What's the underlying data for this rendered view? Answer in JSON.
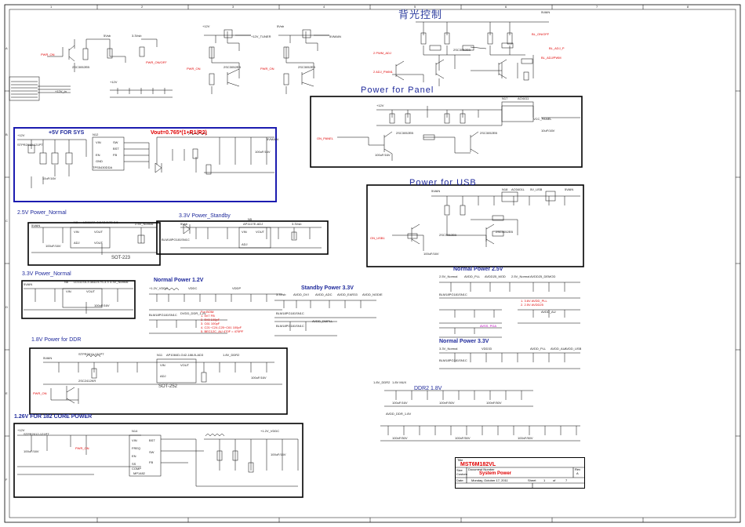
{
  "header_cn": "背光控制",
  "sections": {
    "panel": "Power for Panel",
    "usb": "Power for USB",
    "sys": "+5V FOR SYS",
    "formula": "Vout=0.765*(1+R1/R2)",
    "v25": "2.5V Power_Normal",
    "v33s": "3.3V Power_Standby",
    "v33n": "3.3V Power_Normal",
    "ddr": "1.8V Power for DDR",
    "core": "1.26V FOR 182 CORE POWER",
    "np12": "Normal Power 1.2V",
    "sp33": "Standby Power 3.3V",
    "np25": "Normal Power 2.5V",
    "np33": "Normal Power 3.3V",
    "ddr2": "DDR2 1.8V",
    "sot223": "SOT-223",
    "sot252": "SOT-252"
  },
  "nets": {
    "pwr_on": "PWR_ON",
    "pwr_on_off": "PWR_ON/OFF",
    "v12in": "+12V_in",
    "v5": "5Vsb",
    "v33": "3.3Vsb",
    "v12": "+12V",
    "v12_tuner": "+12V_TUNER",
    "v5main": "5VMAIN",
    "v5vain": "5VAIN",
    "bl_on": "BL_ON/OFF",
    "adj_p": "BL_ADJ_P",
    "adj_pwm": "BL_ADJ/PWM",
    "pwm_adj": "2 PWM_ADJ",
    "pwm0": "2 PWM_PWM0",
    "adj_pwm1": "2 ADJ_PWM1",
    "bl_adjust": "BL_ADJUST",
    "bl_onoff": "BL_ON/OFF",
    "tuner": "12V_TUNER",
    "vcc_panel": "VCC_PANEL",
    "on_panel": "ON_PANEL",
    "v5usb": "5V_USB",
    "on_usb": "ON_USB1",
    "v25n": "2.5V_Normal",
    "v33n": "3.3V_Normal",
    "avdd_ddr": "AVDD_DDR_1.8V",
    "v18ddr": "1.8V_DDR2",
    "v12vddc": "+1.2V_VDDC",
    "avdd_mux": "1.8V MUX",
    "avdd_ddr2": "AVDD_DDR_1.8V",
    "vddp": "VDDP",
    "vddc": "VDDC",
    "avdd_dvi": "AVDD_DVI",
    "avdd_adc": "AVDD_ADC",
    "avdd_ear33": "AVDD_EAR33",
    "avdd_nodie": "AVDD_NODIE",
    "avdd_dmpll": "AVDD_DMPLL",
    "avdd_pll": "AVDD_PLL",
    "avdd_usb": "AVDD_USB",
    "avdd_au": "AVDD_AU",
    "avdd_lpll": "AVDD_LPLL",
    "avdd_demod": "AVDD25_DEMOD",
    "avdd_mod": "AVDD25_MOD",
    "avdd_pga": "AVSS_PGA",
    "vddq": "VDDQ",
    "v33io": "VDD33",
    "vdd_ddr": "DVDD_DDR_1.2V",
    "avdd_rtw": "AVDD_PLL"
  },
  "parts": {
    "u12": "N12",
    "u12_part": "TPS5430DDA",
    "l_sys": "L_SYS",
    "u17": "N17",
    "u17_part": "AO4411",
    "u8": "N8",
    "u8_part": "LD1117A-2.5ADJ17S-2.5",
    "u5": "N5",
    "u5_part": "AP1117E-ADJ",
    "u6": "N6",
    "u6_part": "LD1117A-3.3ADJ17S-3.3",
    "u11": "N11",
    "u11_part": "AP1084D-G42-188-B-AD3",
    "u14": "N14",
    "u14_part": "MP1482",
    "u18": "N18",
    "u18_part": "AO3401L",
    "q16": "Q16",
    "sw": "SW",
    "bst": "BST",
    "vin": "VIN",
    "gnd": "GND",
    "fb": "FB",
    "en": "EN",
    "comp": "COMP",
    "vout": "VOUT",
    "adj": "ADJ",
    "ss": "SS",
    "freq": "FREQ",
    "stpr": "STPR2012-121PT",
    "blm": "BLM18PG181SN1C",
    "c_ref": "100uF/16V",
    "c_ref2": "10uF/16V",
    "c_ref3": "100nF/50V",
    "r_ref": "4.7K",
    "r_ref2": "10K",
    "q_ref": "2SC3052EB",
    "q_ref2": "2SC2412KR"
  },
  "bom_note": {
    "title": "For BOM:",
    "l1": "1. 5V7   FB",
    "l2": "2. 5V8 100pF",
    "l3": "3. C61 100pF",
    "l4": "4. C21~C24,C25~C61 100pF",
    "l5": "5. BEC12C_AU 470F = 470PF"
  },
  "normal25_note": {
    "l1": "1. 3.6V  AVDD_PLL",
    "l2": "2. 2.5V  AVDD25"
  },
  "title_block": {
    "title_label": "Title",
    "title": "MST6M182VL",
    "size_label": "Size",
    "size": "Custom",
    "doc_label": "Document Number",
    "doc": "System Power",
    "rev_label": "Rev",
    "rev": "A",
    "date_label": "Date:",
    "date": "Monday, October 17, 2011",
    "sheet_label": "Sheet",
    "sheet": "1",
    "of_label": "of",
    "of": "7"
  },
  "border": {
    "top_cols": [
      "1",
      "2",
      "3",
      "4",
      "5",
      "6",
      "7",
      "8"
    ],
    "side_rows": [
      "A",
      "B",
      "C",
      "D",
      "E",
      "F"
    ]
  },
  "colors": {
    "wire": "#000000",
    "net_label": "#e00000",
    "pin": "#c000c0",
    "title": "#1f2a9c",
    "box": "#000000",
    "sys_box": "#1c1cb0",
    "red_title": "#e00000"
  }
}
